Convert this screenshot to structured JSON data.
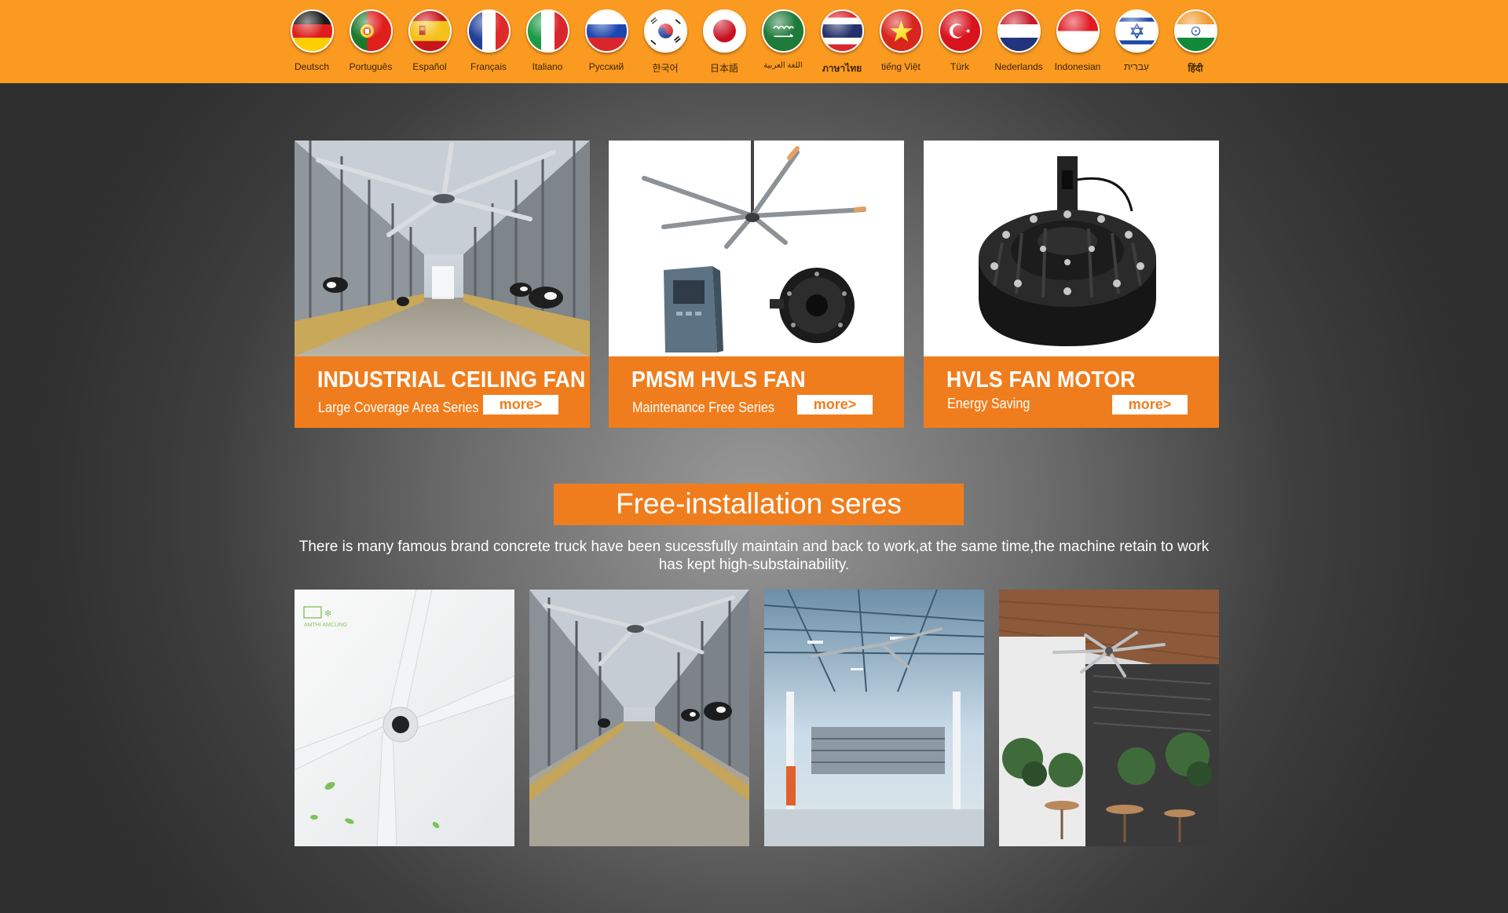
{
  "languages": [
    {
      "label": "Deutsch",
      "flag": "germany-flag-icon"
    },
    {
      "label": "Português",
      "flag": "portugal-flag-icon"
    },
    {
      "label": "Español",
      "flag": "spain-flag-icon"
    },
    {
      "label": "Français",
      "flag": "france-flag-icon"
    },
    {
      "label": "Italiano",
      "flag": "italy-flag-icon"
    },
    {
      "label": "Русский",
      "flag": "russia-flag-icon"
    },
    {
      "label": "한국어",
      "flag": "korea-flag-icon"
    },
    {
      "label": "日本語",
      "flag": "japan-flag-icon"
    },
    {
      "label": "اللغة العربية",
      "flag": "saudi-arabia-flag-icon"
    },
    {
      "label": "ภาษาไทย",
      "flag": "thailand-flag-icon"
    },
    {
      "label": "tiếng Việt",
      "flag": "vietnam-flag-icon"
    },
    {
      "label": "Türk",
      "flag": "turkey-flag-icon"
    },
    {
      "label": "Nederlands",
      "flag": "netherlands-flag-icon"
    },
    {
      "label": "Indonesian",
      "flag": "indonesia-flag-icon"
    },
    {
      "label": "עִברִית",
      "flag": "israel-flag-icon"
    },
    {
      "label": "हिंदी",
      "flag": "india-flag-icon"
    }
  ],
  "products": [
    {
      "title": "INDUSTRIAL CEILING FAN",
      "subtitle": "Large Coverage Area Series",
      "more": "more>",
      "image": "barn-ceiling-fan-image"
    },
    {
      "title": "PMSM HVLS FAN",
      "subtitle": "Maintenance Free Series",
      "more": "more>",
      "image": "hvls-fan-controller-motor-image"
    },
    {
      "title": "HVLS FAN MOTOR",
      "subtitle": "Energy Saving",
      "more": "more>",
      "image": "fan-motor-image"
    }
  ],
  "free_installation": {
    "title": "Free-installation seres",
    "description": "There is many famous brand concrete truck have been sucessfully maintain and back to work,at the same time,the machine retain to work has kept high-substainability.",
    "gallery": [
      {
        "image": "white-fan-closeup-image",
        "logo_text": "AMTHI AMCLING"
      },
      {
        "image": "barn-fan-image"
      },
      {
        "image": "warehouse-fan-image"
      },
      {
        "image": "restaurant-fan-image"
      }
    ]
  },
  "colors": {
    "top_bar": "#fb9a21",
    "accent": "#f07d1d",
    "background_dark": "#2f2f2f",
    "background_light": "#999999"
  }
}
